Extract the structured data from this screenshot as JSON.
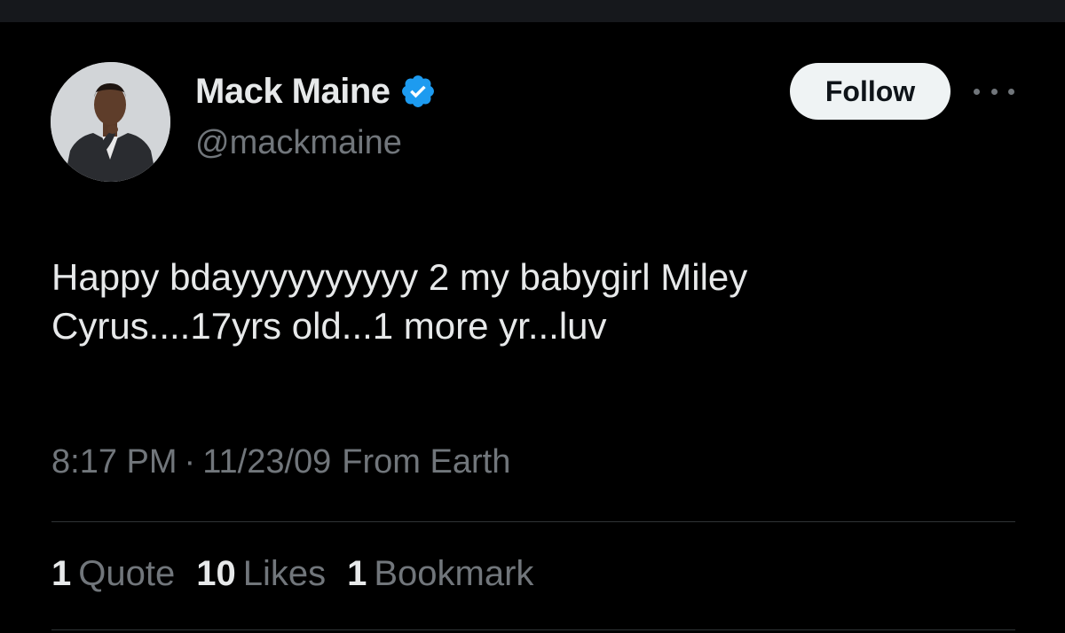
{
  "tweet": {
    "author": {
      "display_name": "Mack Maine",
      "handle": "@mackmaine",
      "verified": true,
      "avatar_icon": "profile-photo"
    },
    "follow_label": "Follow",
    "more_icon": "more-horizontal-icon",
    "text": "Happy bdayyyyyyyyyy 2 my babygirl Miley\nCyrus....17yrs old...1 more yr...luv",
    "time": "8:17 PM",
    "separator": "·",
    "date": "11/23/09",
    "source": "From Earth",
    "stats": [
      {
        "count": "1",
        "label": "Quote"
      },
      {
        "count": "10",
        "label": "Likes"
      },
      {
        "count": "1",
        "label": "Bookmark"
      }
    ]
  },
  "colors": {
    "background": "#000000",
    "primary_text": "#e7e9ea",
    "secondary_text": "#71767b",
    "verified": "#1d9bf0",
    "divider": "#2f3336",
    "follow_bg": "#eff3f4"
  }
}
